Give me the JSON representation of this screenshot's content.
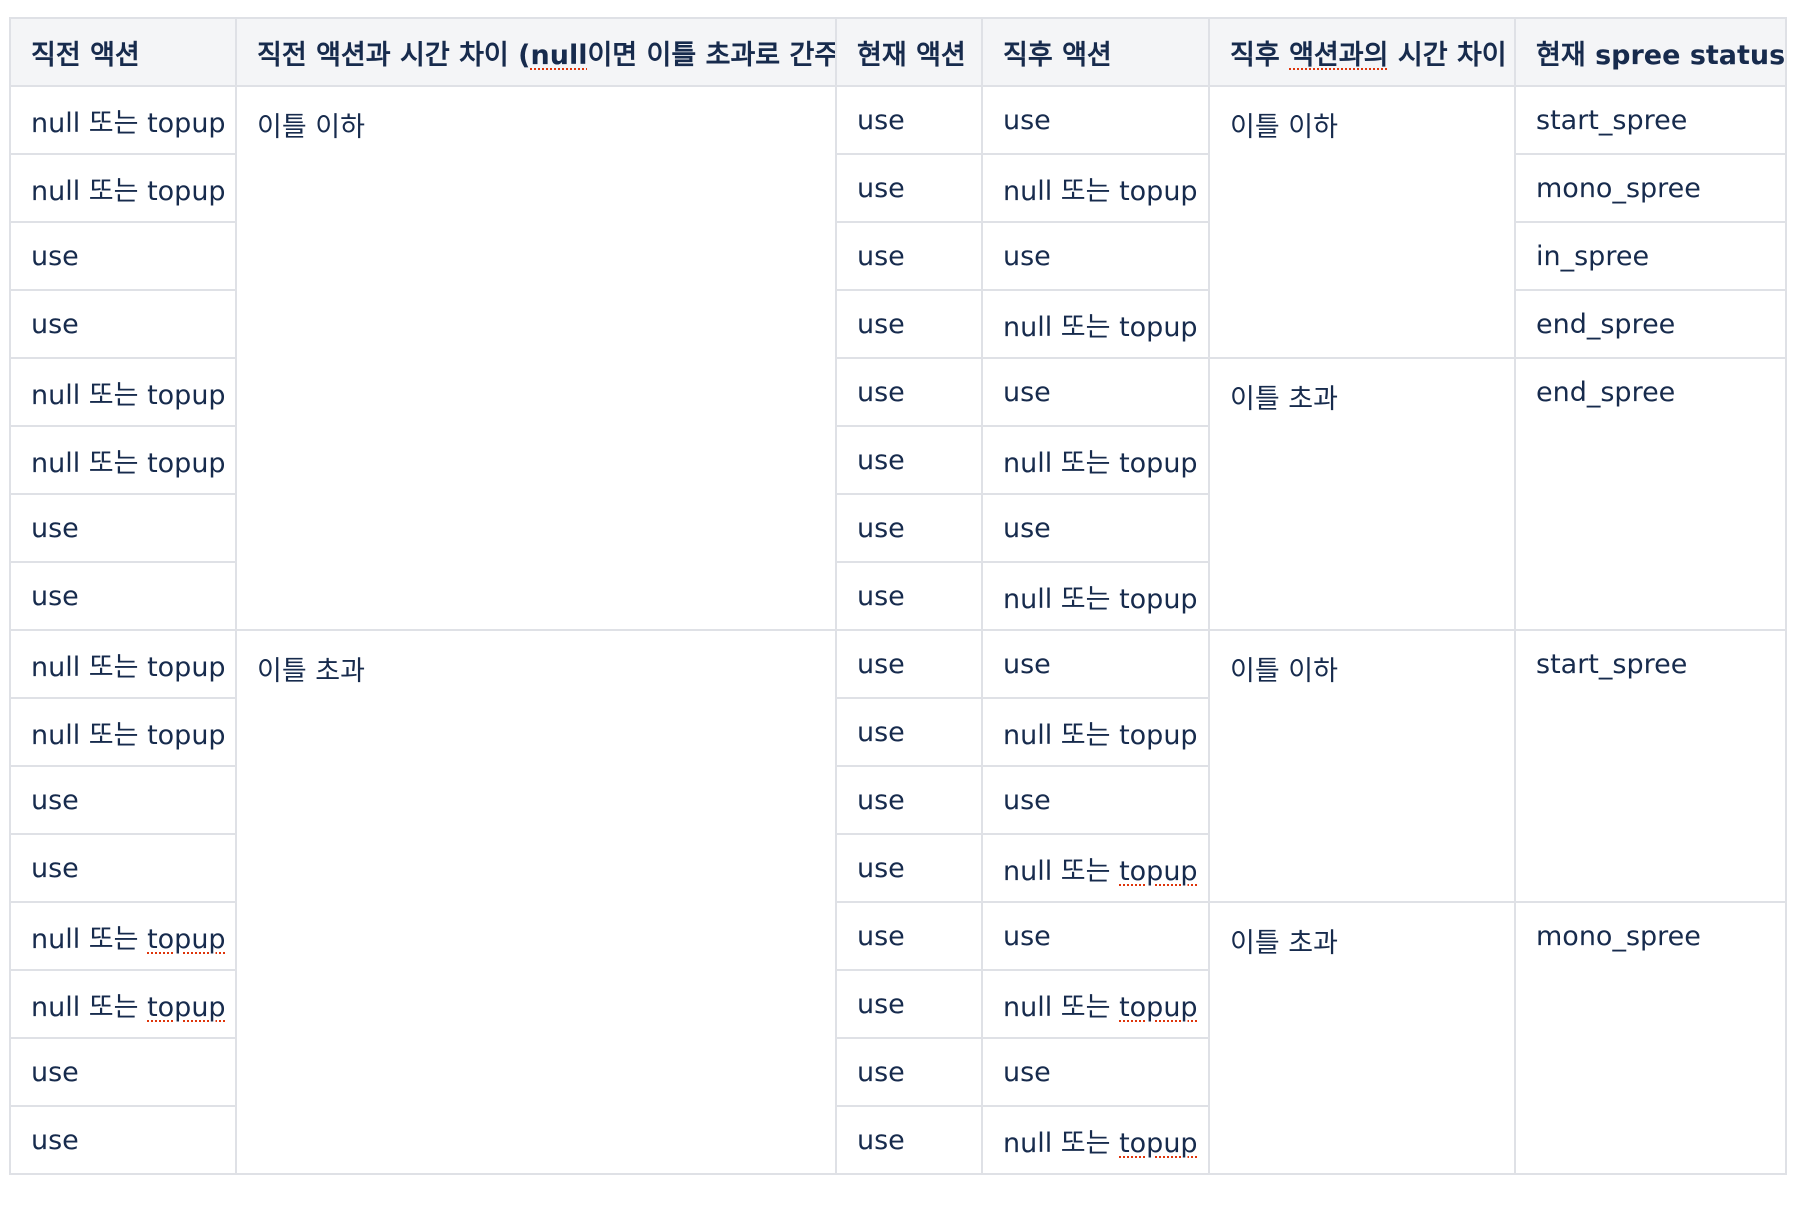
{
  "table": {
    "headers": {
      "prev_action": "직전 액션",
      "prev_gap_pre": "직전 액션과 시간 차이 (",
      "prev_gap_null": "null",
      "prev_gap_post": "이면 이틀 초과로 간주)",
      "curr_action": "현재 액션",
      "next_action": "직후 액션",
      "next_gap_pre": "직후 ",
      "next_gap_mid": "액션과의",
      "next_gap_post": " 시간 차이",
      "status": "현재 spree status"
    },
    "gap_labels": {
      "within_two_days": "이틀 이하",
      "over_two_days": "이틀 초과"
    },
    "action_labels": {
      "null_or_topup_prefix": "null 또는 ",
      "topup": "topup",
      "use": "use"
    },
    "rows": [
      {
        "prev": "null 또는 topup",
        "curr": "use",
        "next": "use"
      },
      {
        "prev": "null 또는 topup",
        "curr": "use",
        "next": "null 또는 topup"
      },
      {
        "prev": "use",
        "curr": "use",
        "next": "use"
      },
      {
        "prev": "use",
        "curr": "use",
        "next": "null 또는 topup"
      },
      {
        "prev": "null 또는 topup",
        "curr": "use",
        "next": "use"
      },
      {
        "prev": "null 또는 topup",
        "curr": "use",
        "next": "null 또는 topup"
      },
      {
        "prev": "use",
        "curr": "use",
        "next": "use"
      },
      {
        "prev": "use",
        "curr": "use",
        "next": "null 또는 topup"
      },
      {
        "prev": "null 또는 topup",
        "curr": "use",
        "next": "use"
      },
      {
        "prev": "null 또는 topup",
        "curr": "use",
        "next": "null 또는 topup"
      },
      {
        "prev": "use",
        "curr": "use",
        "next": "use"
      },
      {
        "prev": "use",
        "curr": "use",
        "next": "null 또는 topup"
      },
      {
        "prev": "null 또는 topup",
        "curr": "use",
        "next": "use"
      },
      {
        "prev": "null 또는 topup",
        "curr": "use",
        "next": "null 또는 topup"
      },
      {
        "prev": "use",
        "curr": "use",
        "next": "use"
      },
      {
        "prev": "use",
        "curr": "use",
        "next": "null 또는 topup"
      }
    ],
    "statuses": {
      "start_spree": "start_spree",
      "mono_spree": "mono_spree",
      "in_spree": "in_spree",
      "end_spree": "end_spree"
    }
  }
}
